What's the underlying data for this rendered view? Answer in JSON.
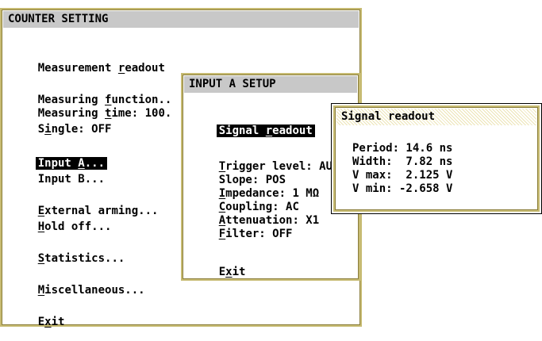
{
  "counter": {
    "title": "COUNTER SETTING",
    "items": [
      {
        "pre": "Measurement ",
        "key": "r",
        "post": "eadout"
      },
      {
        "pre": "Measuring ",
        "key": "f",
        "post": "unction.."
      },
      {
        "pre": "Measuring ",
        "key": "t",
        "post": "ime: 100."
      },
      {
        "pre": "S",
        "key": "i",
        "post": "ngle: OFF"
      },
      {
        "pre": "Input ",
        "key": "A",
        "post": "..."
      },
      {
        "pre": "Input B...",
        "key": "",
        "post": ""
      },
      {
        "pre": "",
        "key": "E",
        "post": "xternal arming..."
      },
      {
        "pre": "",
        "key": "H",
        "post": "old off..."
      },
      {
        "pre": "",
        "key": "S",
        "post": "tatistics..."
      },
      {
        "pre": "",
        "key": "M",
        "post": "iscellaneous..."
      },
      {
        "pre": "E",
        "key": "x",
        "post": "it"
      }
    ]
  },
  "input_a": {
    "title": "INPUT A SETUP",
    "items": [
      {
        "pre": "Signal ",
        "key": "r",
        "post": "eadout"
      },
      {
        "pre": "",
        "key": "T",
        "post": "rigger level: AU"
      },
      {
        "pre": "Slope: POS",
        "key": "",
        "post": ""
      },
      {
        "pre": "",
        "key": "I",
        "post": "mpedance: 1 MΩ"
      },
      {
        "pre": "",
        "key": "C",
        "post": "oupling: AC"
      },
      {
        "pre": "",
        "key": "A",
        "post": "ttenuation: X1"
      },
      {
        "pre": "",
        "key": "F",
        "post": "ilter: OFF"
      },
      {
        "pre": "E",
        "key": "x",
        "post": "it"
      }
    ]
  },
  "signal": {
    "title": "Signal readout",
    "rows": [
      "Period: 14.6 ns",
      "Width:  7.82 ns",
      "V max:  2.125 V",
      "V min: -2.658 V"
    ]
  }
}
